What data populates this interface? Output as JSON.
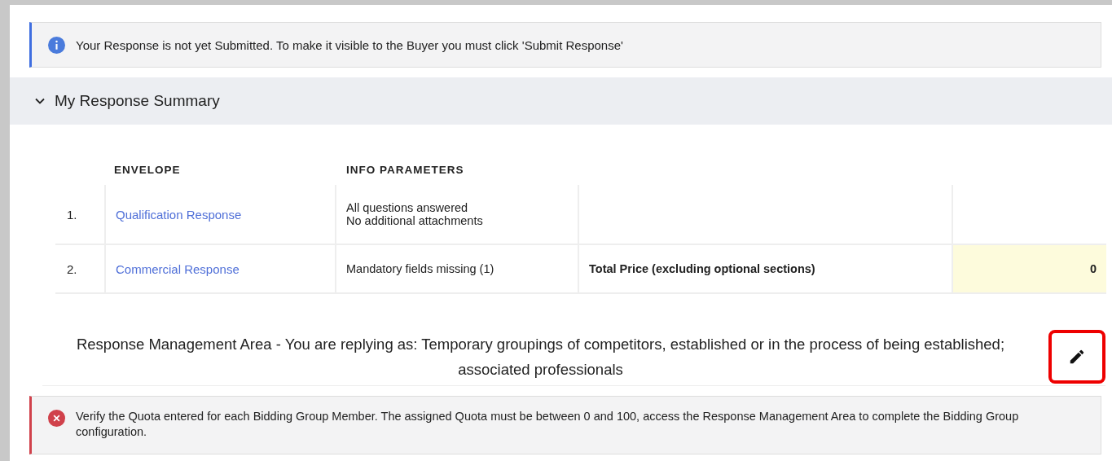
{
  "alerts_top": [
    {
      "kind": "info",
      "text": "Your Response is not yet Submitted. To make it visible to the Buyer you must click 'Submit Response'"
    }
  ],
  "section": {
    "title": "My Response Summary",
    "expanded": true
  },
  "table": {
    "columns": [
      "ENVELOPE",
      "INFO PARAMETERS"
    ],
    "rows": [
      {
        "number": "1.",
        "envelope": "Qualification Response",
        "info": [
          "All questions answered",
          "No additional attachments"
        ]
      },
      {
        "number": "2.",
        "envelope": "Commercial Response",
        "info": [
          "Mandatory fields missing (1)"
        ],
        "label": "Total Price (excluding optional sections)",
        "value": "0"
      }
    ]
  },
  "management": {
    "text": "Response Management Area - You are replying as: Temporary groupings of competitors, established or in the process of being established; associated professionals"
  },
  "alerts_bottom": [
    {
      "kind": "error",
      "text": "Verify the Quota entered for each Bidding Group Member. The assigned Quota must be between 0 and 100, access the Response Management Area to complete the Bidding Group configuration."
    }
  ]
}
